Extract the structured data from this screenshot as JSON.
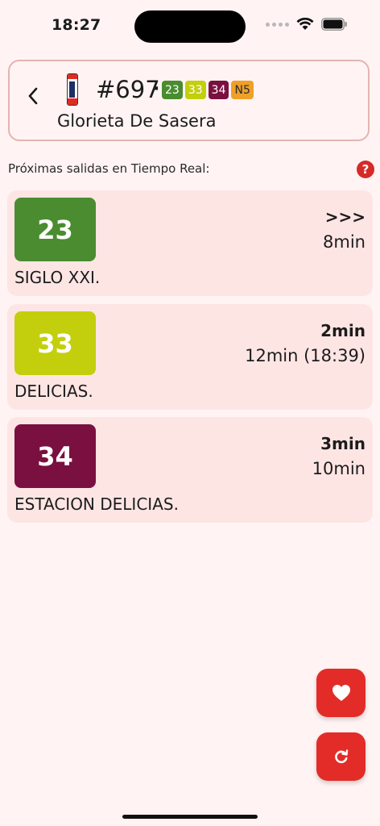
{
  "status_bar": {
    "time": "18:27"
  },
  "header": {
    "stop_number": "#697",
    "separator": "·",
    "stop_name": "Glorieta De Sasera",
    "lines": [
      {
        "label": "23",
        "color": "#4a8c2f"
      },
      {
        "label": "33",
        "color": "#c3cf0c"
      },
      {
        "label": "34",
        "color": "#7a1040"
      },
      {
        "label": "N5",
        "color": "#f0a028"
      }
    ]
  },
  "realtime": {
    "label": "Próximas salidas en Tiempo Real:",
    "help_label": "?"
  },
  "arrivals": [
    {
      "line": "23",
      "color": "#4a8c2f",
      "primary": ">>>",
      "secondary": "8min",
      "destination": "SIGLO XXI."
    },
    {
      "line": "33",
      "color": "#c3cf0c",
      "primary": "2min",
      "secondary": "12min (18:39)",
      "destination": "DELICIAS."
    },
    {
      "line": "34",
      "color": "#7a1040",
      "primary": "3min",
      "secondary": "10min",
      "destination": "ESTACION DELICIAS."
    }
  ],
  "icons": {
    "back": "chevron-left-icon",
    "favorite": "heart-icon",
    "refresh": "refresh-icon",
    "stop": "bus-stop-icon"
  }
}
